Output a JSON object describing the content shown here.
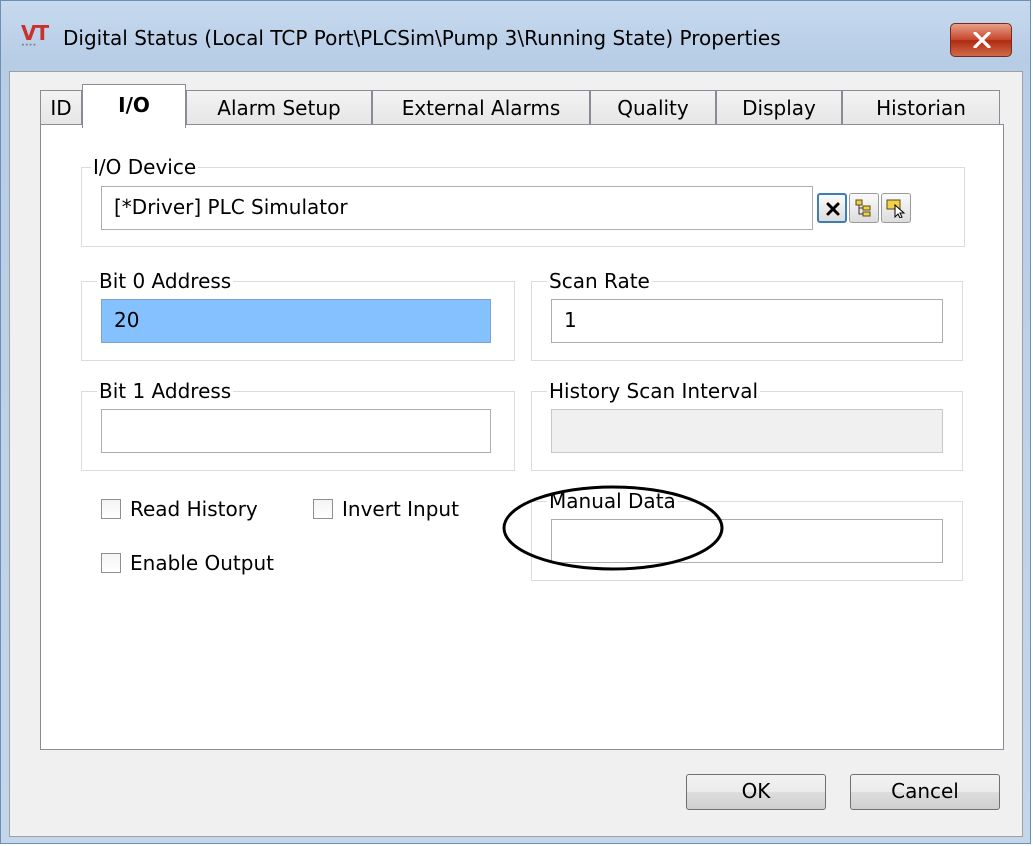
{
  "window": {
    "title": "Digital Status (Local TCP Port\\PLCSim\\Pump 3\\Running State) Properties",
    "logo_text": "VT",
    "close_icon": "close-icon"
  },
  "tabs": [
    {
      "label": "ID",
      "active": false
    },
    {
      "label": "I/O",
      "active": true
    },
    {
      "label": "Alarm Setup",
      "active": false
    },
    {
      "label": "External Alarms",
      "active": false
    },
    {
      "label": "Quality",
      "active": false
    },
    {
      "label": "Display",
      "active": false
    },
    {
      "label": "Historian",
      "active": false
    }
  ],
  "io_device": {
    "label": "I/O Device",
    "value": "[*Driver]   PLC Simulator",
    "buttons": [
      "clear-icon",
      "tree-browse-icon",
      "select-pointer-icon"
    ]
  },
  "bit0": {
    "label": "Bit 0 Address",
    "value": "20"
  },
  "scan_rate": {
    "label": "Scan Rate",
    "value": "1"
  },
  "bit1": {
    "label": "Bit 1 Address",
    "value": ""
  },
  "history_scan": {
    "label": "History Scan Interval",
    "value": ""
  },
  "checkboxes": {
    "read_history": {
      "label": "Read History",
      "checked": false
    },
    "invert_input": {
      "label": "Invert Input",
      "checked": false
    },
    "enable_output": {
      "label": "Enable Output",
      "checked": false
    }
  },
  "manual_data": {
    "label": "Manual Data",
    "value": ""
  },
  "footer": {
    "ok_label": "OK",
    "cancel_label": "Cancel"
  },
  "colors": {
    "selection": "#85c1ff",
    "close_button": "#c5452a",
    "logo": "#c8322d"
  }
}
